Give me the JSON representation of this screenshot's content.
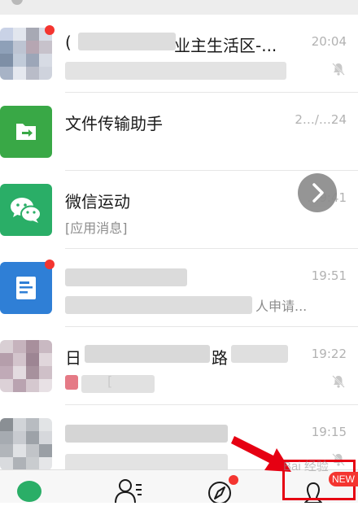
{
  "chats": [
    {
      "title_visible": "(",
      "title_tail": "业主生活区-...",
      "time": "20:04",
      "subtitle": "",
      "muted": true,
      "unread_dot": true
    },
    {
      "title": "文件传输助手",
      "time": "2…/…24",
      "subtitle": ""
    },
    {
      "title": "微信运动",
      "subtitle": "[应用消息]",
      "time": "…9:41"
    },
    {
      "title": "",
      "time": "19:51",
      "subtitle_tail": "人申请...",
      "unread_dot": true
    },
    {
      "title_visible": "日",
      "title_tail": "路",
      "time": "19:22",
      "subtitle_visible": "[",
      "muted": true
    },
    {
      "title": "",
      "time": "19:15",
      "subtitle": "",
      "muted": true
    }
  ],
  "tabbar": {
    "tabs": [
      "chats",
      "contacts",
      "discover",
      "me"
    ],
    "new_label": "NEW"
  },
  "watermark": "Bai 经验",
  "colors": {
    "wechat_green": "#2aae67",
    "file_green": "#39a846",
    "doc_blue": "#2f7fd6",
    "badge_red": "#f43530",
    "annotation_red": "#e60012"
  }
}
